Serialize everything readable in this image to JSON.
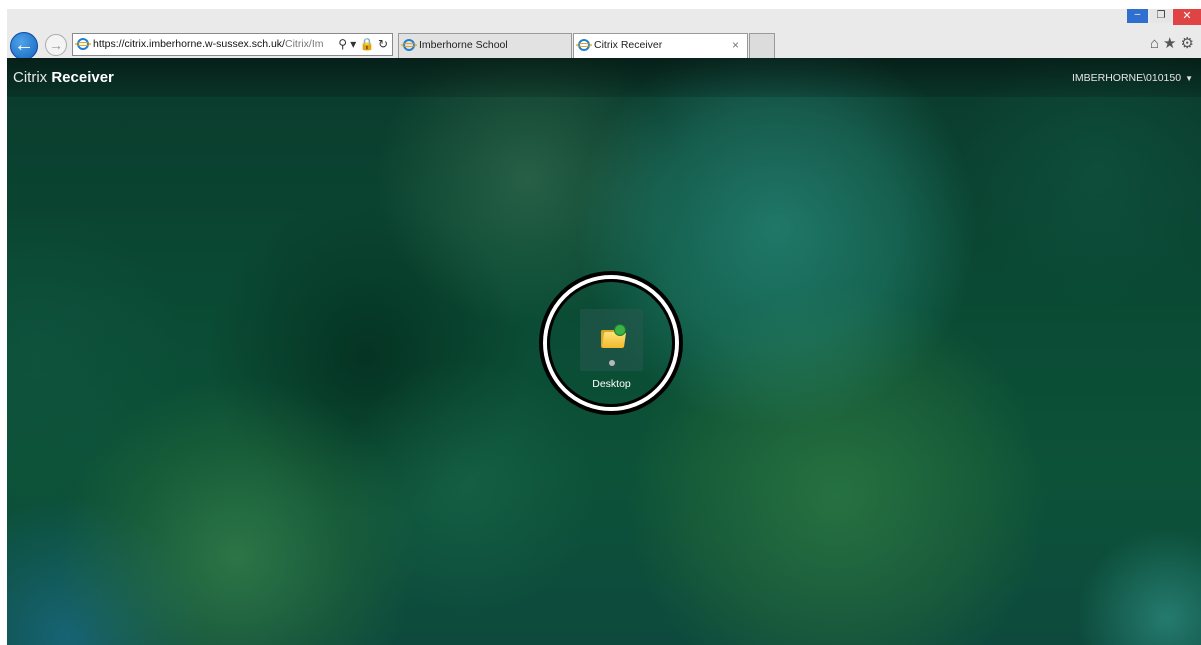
{
  "browser": {
    "url_main": "https://citrix.imberhorne.w-sussex.sch.uk/",
    "url_rest": "Citrix/Im",
    "address_tools": "⚲ ▾ 🔒 ↻",
    "tabs": [
      {
        "title": "Imberhorne School"
      },
      {
        "title": "Citrix Receiver",
        "close": "×"
      }
    ],
    "window_buttons": {
      "minimize": "–",
      "maximize": "❐",
      "close": "✕"
    },
    "toolbar_icons": "⌂★⚙",
    "back_glyph": "←",
    "forward_glyph": "→"
  },
  "app": {
    "brand_light": "Citrix ",
    "brand_bold": "Receiver",
    "user": "IMBERHORNE\\010150",
    "user_caret": "▼",
    "tile": {
      "label": "Desktop",
      "icon": "desktop-folder-icon"
    }
  },
  "colors": {
    "accent_ring": "#000000",
    "tile_bg": "#2a5a50"
  }
}
